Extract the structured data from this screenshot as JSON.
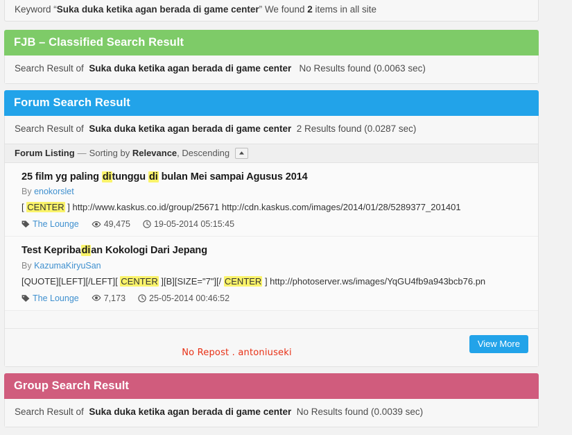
{
  "keyword_bar": {
    "prefix": "Keyword",
    "quote_open": "“",
    "keyword": "Suka duka ketika agan berada di game center",
    "quote_close": "”",
    "found_prefix": "We found",
    "count": "2",
    "found_suffix": "items in all site"
  },
  "fjb_section": {
    "title": "FJB – Classified Search Result",
    "header_color": "#7ECB68",
    "summary_prefix": "Search Result of",
    "summary_keyword": "Suka duka ketika agan berada di game center",
    "summary_suffix": "No Results found (0.0063 sec)"
  },
  "forum_section": {
    "title": "Forum Search Result",
    "header_color": "#22A3E9",
    "summary_prefix": "Search Result of",
    "summary_keyword": "Suka duka ketika agan berada di game center",
    "summary_suffix": "2 Results found (0.0287 sec)",
    "listing": {
      "label": "Forum Listing",
      "dash": "—",
      "sorting_by_text": "Sorting by",
      "sort_field": "Relevance",
      "sort_direction": ", Descending",
      "sort_toggle_icon": "chevron-up-icon"
    },
    "results": [
      {
        "title_parts": [
          {
            "text": "25 film yg paling ",
            "highlight": false
          },
          {
            "text": "di",
            "highlight": true
          },
          {
            "text": "tunggu ",
            "highlight": false
          },
          {
            "text": "di",
            "highlight": true
          },
          {
            "text": " bulan Mei sampai Agusus 2014",
            "highlight": false
          }
        ],
        "by_label": "By",
        "author": "enokorslet",
        "snippet_parts": [
          {
            "text": "[ ",
            "highlight": false
          },
          {
            "text": "CENTER",
            "highlight": true
          },
          {
            "text": " ] http://www.kaskus.co.id/group/25671 http://cdn.kaskus.com/images/2014/01/28/5289377_201401",
            "highlight": false
          }
        ],
        "forum": "The Lounge",
        "forum_icon": "tag-icon",
        "views": "49,475",
        "views_icon": "eye-icon",
        "timestamp": "19-05-2014 05:15:45",
        "timestamp_icon": "clock-icon"
      },
      {
        "title_parts": [
          {
            "text": "Test Kepriba",
            "highlight": false
          },
          {
            "text": "di",
            "highlight": true
          },
          {
            "text": "an Kokologi Dari Jepang",
            "highlight": false
          }
        ],
        "by_label": "By",
        "author": "KazumaKiryuSan",
        "snippet_parts": [
          {
            "text": "[QUOTE][LEFT][/LEFT][ ",
            "highlight": false
          },
          {
            "text": "CENTER",
            "highlight": true
          },
          {
            "text": " ][B][SIZE=\"7\"][/ ",
            "highlight": false
          },
          {
            "text": "CENTER",
            "highlight": true
          },
          {
            "text": " ] http://photoserver.ws/images/YqGU4fb9a943bcb76.pn",
            "highlight": false
          }
        ],
        "forum": "The Lounge",
        "forum_icon": "tag-icon",
        "views": "7,173",
        "views_icon": "eye-icon",
        "timestamp": "25-05-2014 00:46:52",
        "timestamp_icon": "clock-icon"
      }
    ],
    "view_more_label": "View More",
    "watermark": "No Repost . antoniuseki",
    "watermark_color": "#E83015"
  },
  "group_section": {
    "title": "Group Search Result",
    "header_color": "#D05C7D",
    "summary_prefix": "Search Result of",
    "summary_keyword": "Suka duka ketika agan berada di game center",
    "summary_suffix": "No Results found (0.0039 sec)"
  }
}
